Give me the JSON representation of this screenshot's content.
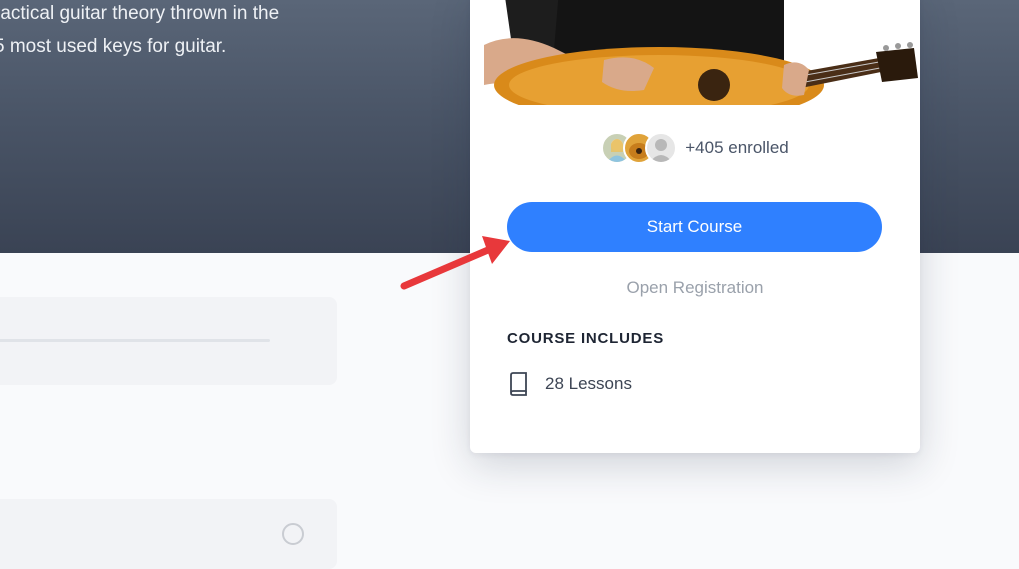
{
  "hero": {
    "line1": "ractical guitar theory thrown in the",
    "line2": "5 most used keys for guitar."
  },
  "card": {
    "enrolled": "+405 enrolled",
    "start_label": "Start Course",
    "open_registration": "Open Registration",
    "includes_title": "COURSE INCLUDES",
    "lessons_label": "28 Lessons"
  },
  "icons": {
    "lessons": "book-icon",
    "status": "circle-check-icon",
    "annotation": "arrow-pointer"
  },
  "colors": {
    "accent": "#2f80ff",
    "hero_bg": "#3a4354",
    "annotation": "#e8383b"
  }
}
